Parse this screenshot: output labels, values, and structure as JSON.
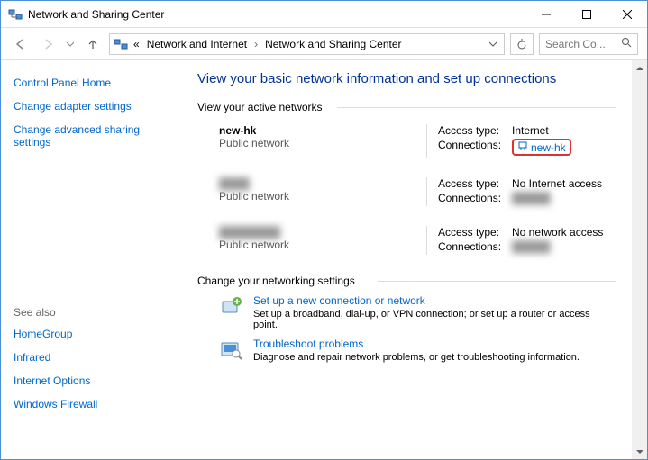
{
  "window": {
    "title": "Network and Sharing Center"
  },
  "breadcrumb": {
    "prefix": "«",
    "items": [
      "Network and Internet",
      "Network and Sharing Center"
    ]
  },
  "search": {
    "placeholder": "Search Co..."
  },
  "sidebar": {
    "home": "Control Panel Home",
    "links": [
      "Change adapter settings",
      "Change advanced sharing settings"
    ],
    "seealso_label": "See also",
    "seealso": [
      "HomeGroup",
      "Infrared",
      "Internet Options",
      "Windows Firewall"
    ]
  },
  "content": {
    "title": "View your basic network information and set up connections",
    "active_label": "View your active networks",
    "networks": [
      {
        "name": "new-hk",
        "type": "Public network",
        "access_label": "Access type:",
        "access_value": "Internet",
        "conn_label": "Connections:",
        "conn_value": "new-hk",
        "highlighted": true,
        "blurred_name": false,
        "blurred_conn": false
      },
      {
        "name": "████",
        "type": "Public network",
        "access_label": "Access type:",
        "access_value": "No Internet access",
        "conn_label": "Connections:",
        "conn_value": "█████",
        "highlighted": false,
        "blurred_name": true,
        "blurred_conn": true
      },
      {
        "name": "████████",
        "type": "Public network",
        "access_label": "Access type:",
        "access_value": "No network access",
        "conn_label": "Connections:",
        "conn_value": "█████",
        "highlighted": false,
        "blurred_name": true,
        "blurred_conn": true
      }
    ],
    "change_label": "Change your networking settings",
    "settings": [
      {
        "link": "Set up a new connection or network",
        "desc": "Set up a broadband, dial-up, or VPN connection; or set up a router or access point."
      },
      {
        "link": "Troubleshoot problems",
        "desc": "Diagnose and repair network problems, or get troubleshooting information."
      }
    ]
  }
}
